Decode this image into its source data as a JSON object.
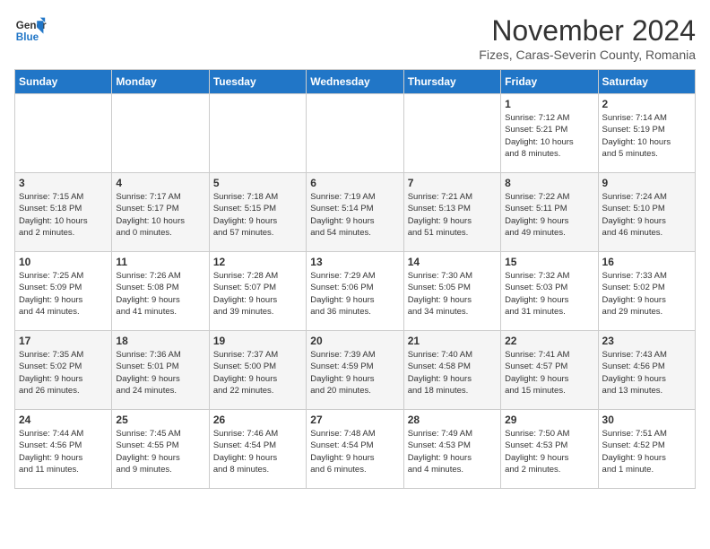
{
  "logo": {
    "line1": "General",
    "line2": "Blue"
  },
  "title": "November 2024",
  "subtitle": "Fizes, Caras-Severin County, Romania",
  "days_of_week": [
    "Sunday",
    "Monday",
    "Tuesday",
    "Wednesday",
    "Thursday",
    "Friday",
    "Saturday"
  ],
  "weeks": [
    [
      {
        "day": "",
        "info": ""
      },
      {
        "day": "",
        "info": ""
      },
      {
        "day": "",
        "info": ""
      },
      {
        "day": "",
        "info": ""
      },
      {
        "day": "",
        "info": ""
      },
      {
        "day": "1",
        "info": "Sunrise: 7:12 AM\nSunset: 5:21 PM\nDaylight: 10 hours\nand 8 minutes."
      },
      {
        "day": "2",
        "info": "Sunrise: 7:14 AM\nSunset: 5:19 PM\nDaylight: 10 hours\nand 5 minutes."
      }
    ],
    [
      {
        "day": "3",
        "info": "Sunrise: 7:15 AM\nSunset: 5:18 PM\nDaylight: 10 hours\nand 2 minutes."
      },
      {
        "day": "4",
        "info": "Sunrise: 7:17 AM\nSunset: 5:17 PM\nDaylight: 10 hours\nand 0 minutes."
      },
      {
        "day": "5",
        "info": "Sunrise: 7:18 AM\nSunset: 5:15 PM\nDaylight: 9 hours\nand 57 minutes."
      },
      {
        "day": "6",
        "info": "Sunrise: 7:19 AM\nSunset: 5:14 PM\nDaylight: 9 hours\nand 54 minutes."
      },
      {
        "day": "7",
        "info": "Sunrise: 7:21 AM\nSunset: 5:13 PM\nDaylight: 9 hours\nand 51 minutes."
      },
      {
        "day": "8",
        "info": "Sunrise: 7:22 AM\nSunset: 5:11 PM\nDaylight: 9 hours\nand 49 minutes."
      },
      {
        "day": "9",
        "info": "Sunrise: 7:24 AM\nSunset: 5:10 PM\nDaylight: 9 hours\nand 46 minutes."
      }
    ],
    [
      {
        "day": "10",
        "info": "Sunrise: 7:25 AM\nSunset: 5:09 PM\nDaylight: 9 hours\nand 44 minutes."
      },
      {
        "day": "11",
        "info": "Sunrise: 7:26 AM\nSunset: 5:08 PM\nDaylight: 9 hours\nand 41 minutes."
      },
      {
        "day": "12",
        "info": "Sunrise: 7:28 AM\nSunset: 5:07 PM\nDaylight: 9 hours\nand 39 minutes."
      },
      {
        "day": "13",
        "info": "Sunrise: 7:29 AM\nSunset: 5:06 PM\nDaylight: 9 hours\nand 36 minutes."
      },
      {
        "day": "14",
        "info": "Sunrise: 7:30 AM\nSunset: 5:05 PM\nDaylight: 9 hours\nand 34 minutes."
      },
      {
        "day": "15",
        "info": "Sunrise: 7:32 AM\nSunset: 5:03 PM\nDaylight: 9 hours\nand 31 minutes."
      },
      {
        "day": "16",
        "info": "Sunrise: 7:33 AM\nSunset: 5:02 PM\nDaylight: 9 hours\nand 29 minutes."
      }
    ],
    [
      {
        "day": "17",
        "info": "Sunrise: 7:35 AM\nSunset: 5:02 PM\nDaylight: 9 hours\nand 26 minutes."
      },
      {
        "day": "18",
        "info": "Sunrise: 7:36 AM\nSunset: 5:01 PM\nDaylight: 9 hours\nand 24 minutes."
      },
      {
        "day": "19",
        "info": "Sunrise: 7:37 AM\nSunset: 5:00 PM\nDaylight: 9 hours\nand 22 minutes."
      },
      {
        "day": "20",
        "info": "Sunrise: 7:39 AM\nSunset: 4:59 PM\nDaylight: 9 hours\nand 20 minutes."
      },
      {
        "day": "21",
        "info": "Sunrise: 7:40 AM\nSunset: 4:58 PM\nDaylight: 9 hours\nand 18 minutes."
      },
      {
        "day": "22",
        "info": "Sunrise: 7:41 AM\nSunset: 4:57 PM\nDaylight: 9 hours\nand 15 minutes."
      },
      {
        "day": "23",
        "info": "Sunrise: 7:43 AM\nSunset: 4:56 PM\nDaylight: 9 hours\nand 13 minutes."
      }
    ],
    [
      {
        "day": "24",
        "info": "Sunrise: 7:44 AM\nSunset: 4:56 PM\nDaylight: 9 hours\nand 11 minutes."
      },
      {
        "day": "25",
        "info": "Sunrise: 7:45 AM\nSunset: 4:55 PM\nDaylight: 9 hours\nand 9 minutes."
      },
      {
        "day": "26",
        "info": "Sunrise: 7:46 AM\nSunset: 4:54 PM\nDaylight: 9 hours\nand 8 minutes."
      },
      {
        "day": "27",
        "info": "Sunrise: 7:48 AM\nSunset: 4:54 PM\nDaylight: 9 hours\nand 6 minutes."
      },
      {
        "day": "28",
        "info": "Sunrise: 7:49 AM\nSunset: 4:53 PM\nDaylight: 9 hours\nand 4 minutes."
      },
      {
        "day": "29",
        "info": "Sunrise: 7:50 AM\nSunset: 4:53 PM\nDaylight: 9 hours\nand 2 minutes."
      },
      {
        "day": "30",
        "info": "Sunrise: 7:51 AM\nSunset: 4:52 PM\nDaylight: 9 hours\nand 1 minute."
      }
    ]
  ]
}
